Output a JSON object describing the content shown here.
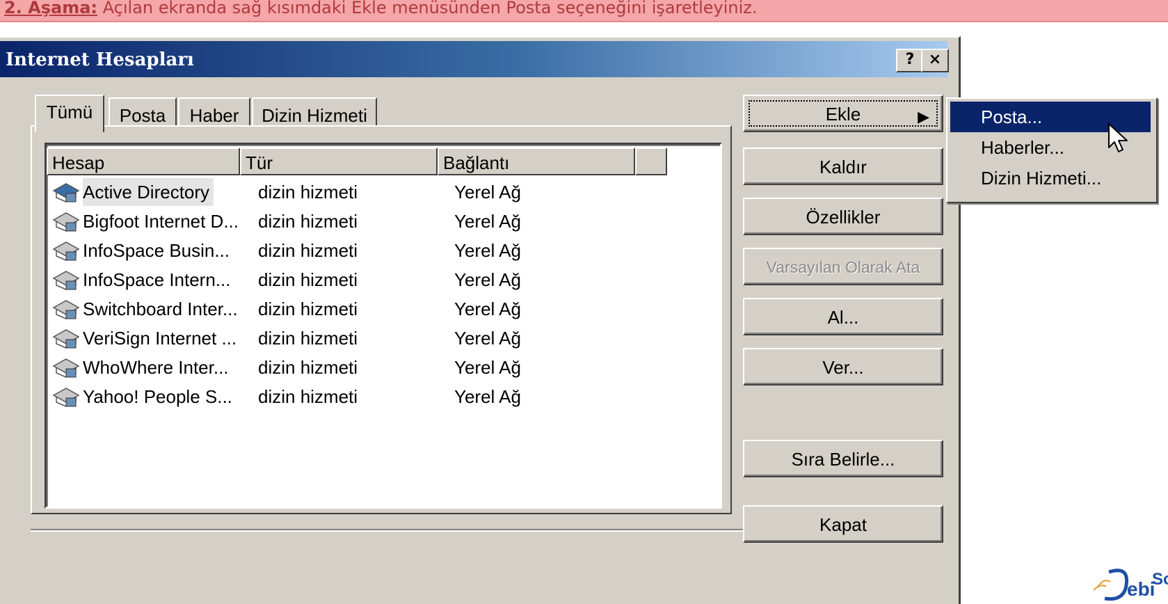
{
  "instruction": {
    "step": "2. Aşama:",
    "text": " Açılan ekranda sağ kısımdaki Ekle menüsünden Posta seçeneğini işaretleyiniz."
  },
  "window": {
    "title": "Internet Hesapları",
    "help_label": "?",
    "close_label": "×"
  },
  "tabs": [
    {
      "label": "Tümü"
    },
    {
      "label": "Posta"
    },
    {
      "label": "Haber"
    },
    {
      "label": "Dizin Hizmeti"
    }
  ],
  "columns": [
    "Hesap",
    "Tür",
    "Bağlantı",
    ""
  ],
  "rows": [
    {
      "account": "Active Directory",
      "type": "dizin hizmeti",
      "connection": "Yerel Ağ"
    },
    {
      "account": "Bigfoot Internet D...",
      "type": "dizin hizmeti",
      "connection": "Yerel Ağ"
    },
    {
      "account": "InfoSpace Busin...",
      "type": "dizin hizmeti",
      "connection": "Yerel Ağ"
    },
    {
      "account": "InfoSpace Intern...",
      "type": "dizin hizmeti",
      "connection": "Yerel Ağ"
    },
    {
      "account": "Switchboard Inter...",
      "type": "dizin hizmeti",
      "connection": "Yerel Ağ"
    },
    {
      "account": "VeriSign Internet ...",
      "type": "dizin hizmeti",
      "connection": "Yerel Ağ"
    },
    {
      "account": "WhoWhere Inter...",
      "type": "dizin hizmeti",
      "connection": "Yerel Ağ"
    },
    {
      "account": "Yahoo! People S...",
      "type": "dizin hizmeti",
      "connection": "Yerel Ağ"
    }
  ],
  "buttons": {
    "add": "Ekle",
    "remove": "Kaldır",
    "properties": "Özellikler",
    "set_default": "Varsayılan Olarak Ata",
    "import": "Al...",
    "export": "Ver...",
    "set_order": "Sıra Belirle...",
    "close": "Kapat"
  },
  "add_menu": {
    "items": [
      "Posta...",
      "Haberler...",
      "Dizin Hizmeti..."
    ]
  },
  "logo": "DebiSoft",
  "colors": {
    "banner_bg": "#f4a6a8",
    "banner_text": "#b03a3e",
    "titlebar_start": "#0a246a",
    "titlebar_end": "#a6caf0",
    "dialog_face": "#d4d0c8",
    "menu_highlight": "#0a246a"
  }
}
